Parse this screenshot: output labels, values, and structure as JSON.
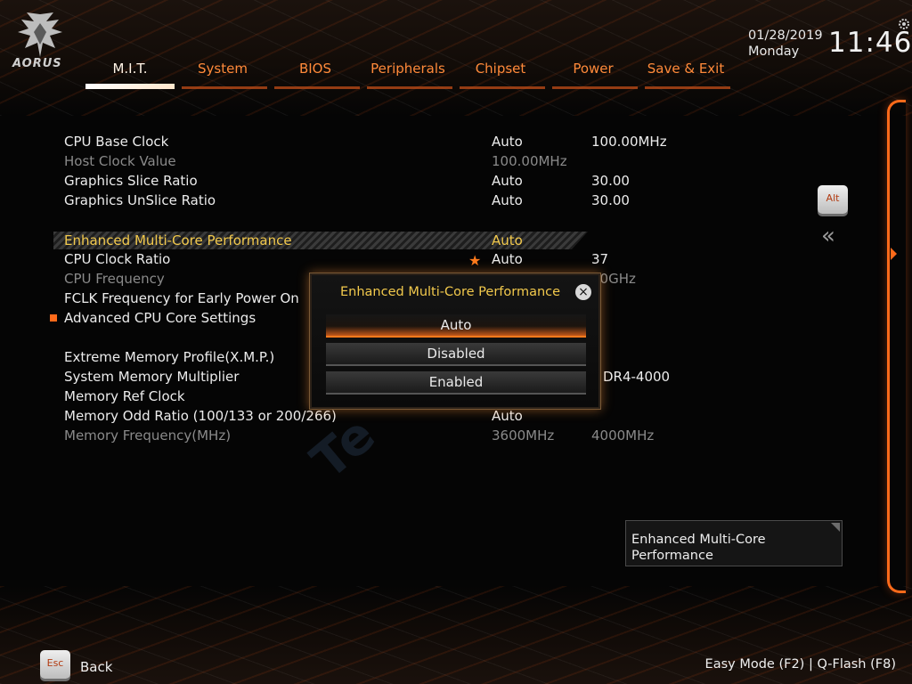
{
  "brand": {
    "logo_text": "AORUS"
  },
  "tabs": [
    {
      "label": "M.I.T.",
      "active": true
    },
    {
      "label": "System"
    },
    {
      "label": "BIOS"
    },
    {
      "label": "Peripherals"
    },
    {
      "label": "Chipset"
    },
    {
      "label": "Power"
    },
    {
      "label": "Save & Exit"
    }
  ],
  "datetime": {
    "date": "01/28/2019",
    "day": "Monday",
    "time": "11:46"
  },
  "settings": [
    {
      "label": "CPU Base Clock",
      "v1": "Auto",
      "v2": "100.00MHz"
    },
    {
      "label": "Host Clock Value",
      "v1": "100.00MHz",
      "v2": ""
    },
    {
      "label": "Graphics Slice Ratio",
      "v1": "Auto",
      "v2": "30.00"
    },
    {
      "label": "Graphics UnSlice Ratio",
      "v1": "Auto",
      "v2": "30.00"
    },
    {
      "label": "Enhanced Multi-Core Performance",
      "v1": "Auto",
      "v2": ""
    },
    {
      "label": "CPU Clock Ratio",
      "v1": "Auto",
      "v2": "37"
    },
    {
      "label": "CPU Frequency",
      "v1": "",
      "v2": "70GHz"
    },
    {
      "label": "FCLK Frequency for Early Power On",
      "v1": "",
      "v2": ""
    },
    {
      "label": "Advanced CPU Core Settings",
      "v1": "",
      "v2": ""
    },
    {
      "label": "Extreme Memory Profile(X.M.P.)",
      "v1": "",
      "v2": ""
    },
    {
      "label": "System Memory Multiplier",
      "v1": "",
      "v2": "DR4-4000"
    },
    {
      "label": "Memory Ref Clock",
      "v1": "",
      "v2": ""
    },
    {
      "label": "Memory Odd Ratio (100/133 or 200/266)",
      "v1": "Auto",
      "v2": ""
    },
    {
      "label": "Memory Frequency(MHz)",
      "v1": "3600MHz",
      "v2": "4000MHz"
    }
  ],
  "watermark": "Te",
  "modal": {
    "title": "Enhanced Multi-Core Performance",
    "close_icon": "×",
    "options": [
      "Auto",
      "Disabled",
      "Enabled"
    ],
    "selected": "Auto"
  },
  "side": {
    "alt_key": "Alt",
    "chevron": "«"
  },
  "help": {
    "text_line1": "Enhanced Multi-Core",
    "text_line2": "Performance"
  },
  "footer": {
    "esc_key": "Esc",
    "back_label": "Back",
    "easy_mode": "Easy Mode (F2)",
    "separator": "|",
    "qflash": "Q-Flash (F8)"
  },
  "colors": {
    "accent": "#ff6a1a",
    "highlight_text": "#f2c94c",
    "tab_text": "#ff8a3a"
  }
}
